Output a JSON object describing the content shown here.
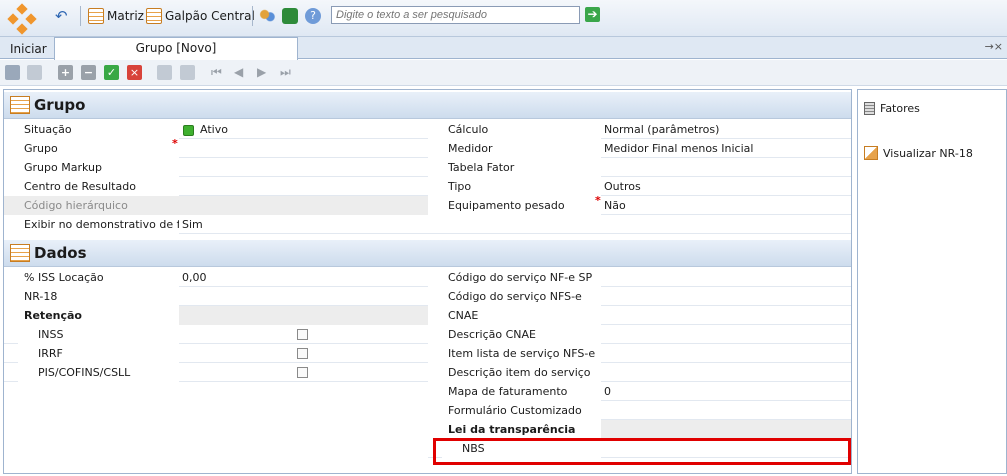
{
  "toolbar": {
    "matriz": "Matriz",
    "galpao": "Galpão Central",
    "search_placeholder": "Digite o texto a ser pesquisado",
    "go_icon": "arrow-right-icon"
  },
  "tabs": {
    "home": "Iniciar",
    "active": "Grupo [Novo]",
    "controls": "→×"
  },
  "grupo": {
    "title": "Grupo",
    "left": [
      {
        "label": "Situação",
        "value": "Ativo"
      },
      {
        "label": "Grupo",
        "value": ""
      },
      {
        "label": "Grupo Markup",
        "value": ""
      },
      {
        "label": "Centro de Resultado",
        "value": ""
      },
      {
        "label": "Código hierárquico",
        "value": ""
      },
      {
        "label": "Exibir no demonstrativo de fatu",
        "value": "Sim"
      }
    ],
    "right": [
      {
        "label": "Cálculo",
        "value": "Normal (parâmetros)"
      },
      {
        "label": "Medidor",
        "value": "Medidor Final menos Inicial"
      },
      {
        "label": "Tabela Fator",
        "value": ""
      },
      {
        "label": "Tipo",
        "value": "Outros"
      },
      {
        "label": "Equipamento pesado",
        "value": "Não"
      }
    ]
  },
  "dados": {
    "title": "Dados",
    "left": [
      {
        "label": "% ISS Locação",
        "value": "0,00"
      },
      {
        "label": "NR-18",
        "value": ""
      },
      {
        "label": "Retenção",
        "value": ""
      },
      {
        "label": "INSS",
        "value": ""
      },
      {
        "label": "IRRF",
        "value": ""
      },
      {
        "label": "PIS/COFINS/CSLL",
        "value": ""
      }
    ],
    "right": [
      {
        "label": "Código do serviço NF-e SP",
        "value": ""
      },
      {
        "label": "Código do serviço NFS-e",
        "value": ""
      },
      {
        "label": "CNAE",
        "value": ""
      },
      {
        "label": "Descrição CNAE",
        "value": ""
      },
      {
        "label": "Item lista de serviço NFS-e",
        "value": ""
      },
      {
        "label": "Descrição item do serviço",
        "value": ""
      },
      {
        "label": "Mapa de faturamento",
        "value": "0"
      },
      {
        "label": "Formulário Customizado",
        "value": ""
      },
      {
        "label": "Lei da transparência",
        "value": ""
      },
      {
        "label": "NBS",
        "value": ""
      }
    ]
  },
  "side": {
    "fatores": "Fatores",
    "visualizar": "Visualizar NR-18"
  },
  "colors": {
    "accent": "#f0962d",
    "highlight": "#e00000",
    "active_green": "#3fb02f"
  }
}
